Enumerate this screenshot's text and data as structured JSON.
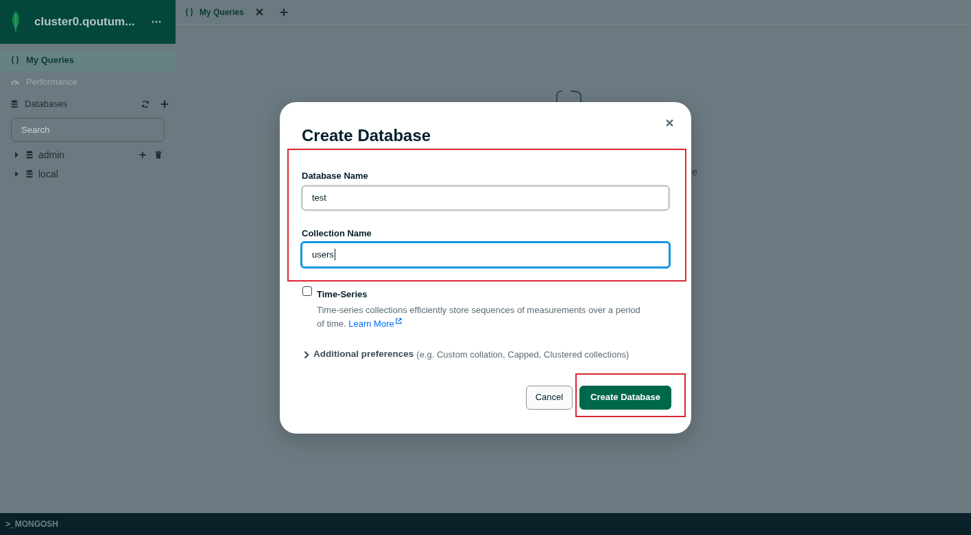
{
  "sidebar": {
    "connection_title": "cluster0.qoutum...",
    "nav_items": [
      {
        "kind": "queries",
        "label": "My Queries",
        "selected": true,
        "disabled": false
      },
      {
        "kind": "performance",
        "label": "Performance",
        "selected": false,
        "disabled": true
      },
      {
        "kind": "databases",
        "label": "Databases",
        "selected": false,
        "disabled": false
      }
    ],
    "search": {
      "placeholder": "Search"
    },
    "databases": [
      {
        "name": "admin",
        "expanded": false,
        "hovered": true
      },
      {
        "name": "local",
        "expanded": false,
        "hovered": false
      }
    ]
  },
  "tabs": [
    {
      "label": "My Queries",
      "selected": true
    }
  ],
  "workspace": {
    "text_fragment": "e"
  },
  "modal": {
    "title": "Create Database",
    "fields_highlighted": true,
    "fields": [
      {
        "label": "Database Name",
        "value": "test",
        "focused": false
      },
      {
        "label": "Collection Name",
        "value": "users",
        "focused": true
      }
    ],
    "time_series": {
      "label": "Time-Series",
      "checked": false,
      "description": "Time-series collections efficiently store sequences of measurements over a period of time.",
      "link": "Learn More"
    },
    "additional_preferences": {
      "label": "Additional preferences",
      "hint": "(e.g. Custom collation, Capped, Clustered collections)",
      "expanded": false
    },
    "buttons": [
      {
        "label": "Cancel",
        "kind": "secondary",
        "highlighted": false
      },
      {
        "label": "Create Database",
        "kind": "primary",
        "highlighted": true
      }
    ]
  },
  "shell_bar": {
    "label": ">_MONGOSH"
  }
}
